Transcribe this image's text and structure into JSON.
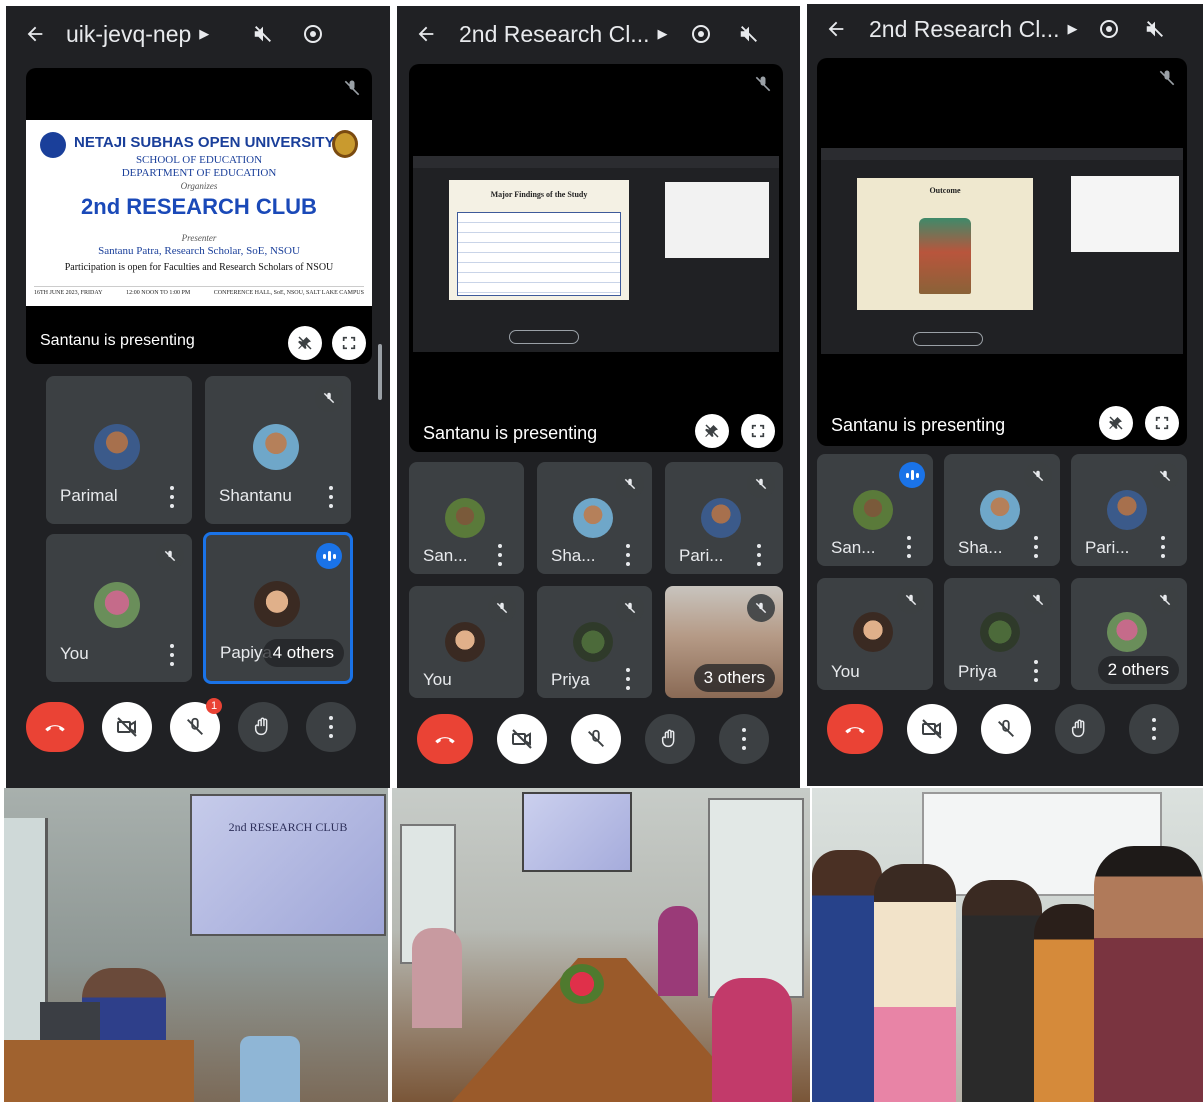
{
  "screens": [
    {
      "title": "uik-jevq-nep",
      "presenting": "Santanu is presenting",
      "poster": {
        "university": "NETAJI SUBHAS OPEN UNIVERSITY",
        "school": "SCHOOL OF EDUCATION",
        "department": "DEPARTMENT OF EDUCATION",
        "organizes": "Organizes",
        "event": "2nd RESEARCH CLUB",
        "presenter_label": "Presenter",
        "presenter": "Santanu Patra, Research Scholar, SoE, NSOU",
        "participation": "Participation is open for Faculties and Research Scholars of NSOU",
        "date": "16TH JUNE 2023, FRIDAY",
        "time": "12:00 NOON TO 1:00 PM",
        "venue": "CONFERENCE HALL, SoE, NSOU, SALT LAKE CAMPUS"
      },
      "tiles": [
        "Parimal",
        "Shantanu",
        "You",
        "Papiya"
      ],
      "others": "4 others",
      "badge": "1"
    },
    {
      "title": "2nd Research Cl...",
      "presenting": "Santanu is presenting",
      "slide_title": "Major Findings of the Study",
      "tiles": [
        "San...",
        "Sha...",
        "Pari...",
        "You",
        "Priya"
      ],
      "others": "3 others"
    },
    {
      "title": "2nd Research Cl...",
      "presenting": "Santanu is presenting",
      "slide_title": "Outcome",
      "tiles": [
        "San...",
        "Sha...",
        "Pari...",
        "You",
        "Priya"
      ],
      "others": "2 others"
    }
  ],
  "photos": {
    "projector_text_1": "2nd RESEARCH CLUB"
  }
}
